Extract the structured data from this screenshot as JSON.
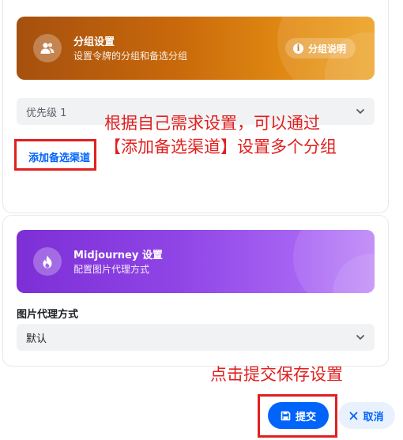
{
  "group_card": {
    "banner": {
      "title": "分组设置",
      "subtitle": "设置令牌的分组和备选分组",
      "help_button": "分组说明",
      "icon": "users-icon"
    },
    "priority_select": {
      "value": "优先级 1"
    },
    "add_backup_link": "添加备选渠道"
  },
  "midjourney_card": {
    "banner": {
      "title": "Midjourney 设置",
      "subtitle": "配置图片代理方式",
      "icon": "flame-icon"
    },
    "proxy_label": "图片代理方式",
    "proxy_select": {
      "value": "默认"
    }
  },
  "annotations": {
    "add_hint_line1": "根据自己需求设置，可以通过",
    "add_hint_line2": "【添加备选渠道】设置多个分组",
    "submit_hint": "点击提交保存设置"
  },
  "footer": {
    "submit_label": "提交",
    "cancel_label": "取消"
  },
  "colors": {
    "primary": "#0064fa",
    "annotation_red": "#e0201f",
    "group_banner": "#c9690b",
    "midjourney_banner": "#8f45e6"
  }
}
